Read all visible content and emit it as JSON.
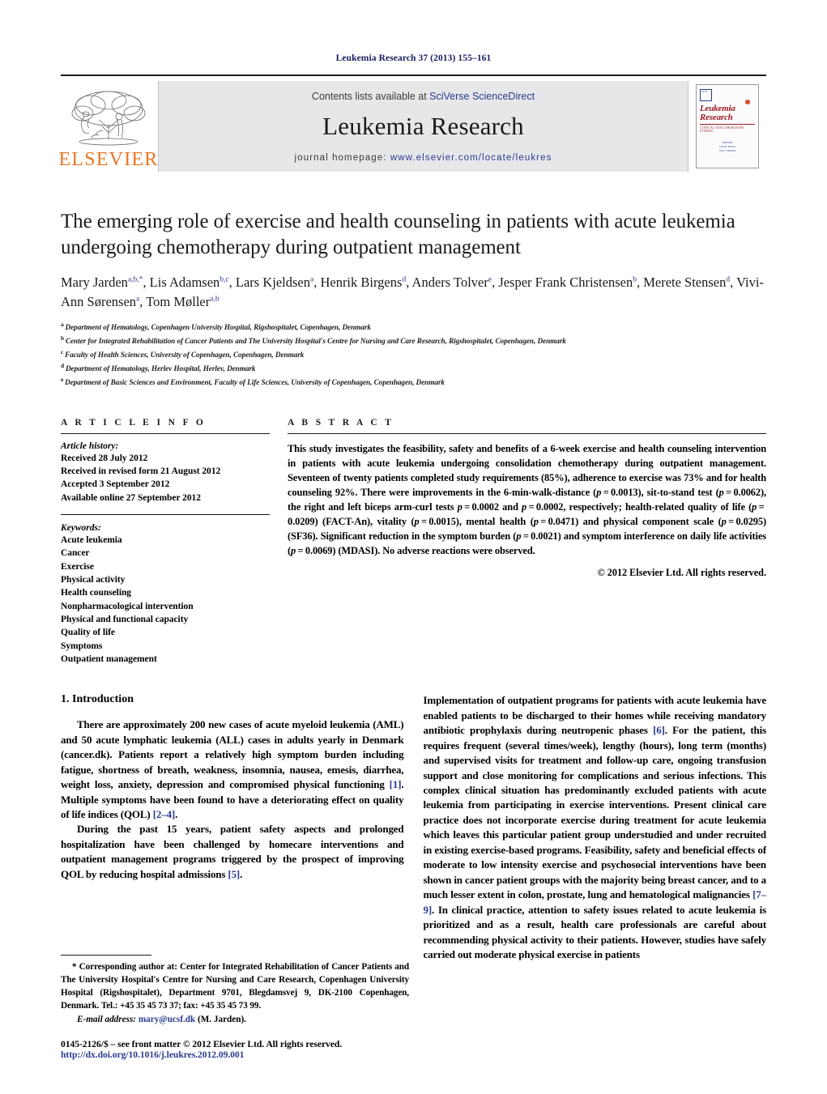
{
  "running_head": "Leukemia Research 37 (2013) 155–161",
  "masthead": {
    "publisher_logo_text": "ELSEVIER",
    "contents_prefix": "Contents lists available at ",
    "contents_link": "SciVerse ScienceDirect",
    "journal_name": "Leukemia Research",
    "homepage_label": "journal homepage:",
    "homepage_url": "www.elsevier.com/locate/leukres",
    "cover": {
      "title_line1": "Leukemia",
      "title_line2": "Research",
      "subtitle": "Clinical and Laboratory Studies",
      "badge": "IACR",
      "foot_label": "EDITORS",
      "foot_left_name": "John M. Bennett",
      "foot_left_place": "USA",
      "foot_right_name": "Terry J. Hamblin",
      "foot_right_place": "UK"
    }
  },
  "article": {
    "title": "The emerging role of exercise and health counseling in patients with acute leukemia undergoing chemotherapy during outpatient management",
    "authors_line1": "Mary Jarden",
    "authors_line1_sup": "a,b,*",
    "authors": [
      {
        "name": "Mary Jarden",
        "sup": "a,b,*"
      },
      {
        "name": "Lis Adamsen",
        "sup": "b,c"
      },
      {
        "name": "Lars Kjeldsen",
        "sup": "a"
      },
      {
        "name": "Henrik Birgens",
        "sup": "d"
      },
      {
        "name": "Anders Tolver",
        "sup": "e"
      },
      {
        "name": "Jesper Frank Christensen",
        "sup": "b"
      },
      {
        "name": "Merete Stensen",
        "sup": "d"
      },
      {
        "name": "Vivi-Ann Sørensen",
        "sup": "a"
      },
      {
        "name": "Tom Møller",
        "sup": "a,b"
      }
    ],
    "affiliations": [
      {
        "mark": "a",
        "text": "Department of Hematology, Copenhagen University Hospital, Rigshospitalet, Copenhagen, Denmark"
      },
      {
        "mark": "b",
        "text": "Center for Integrated Rehabilitation of Cancer Patients and The University Hospital's Centre for Nursing and Care Research, Rigshospitalet, Copenhagen, Denmark"
      },
      {
        "mark": "c",
        "text": "Faculty of Health Sciences, University of Copenhagen, Copenhagen, Denmark"
      },
      {
        "mark": "d",
        "text": "Department of Hematology, Herlev Hospital, Herlev, Denmark"
      },
      {
        "mark": "e",
        "text": "Department of Basic Sciences and Environment, Faculty of Life Sciences, University of Copenhagen, Copenhagen, Denmark"
      }
    ]
  },
  "article_info": {
    "heading": "A R T I C L E   I N F O",
    "history_label": "Article history:",
    "history": [
      "Received 28 July 2012",
      "Received in revised form 21 August 2012",
      "Accepted 3 September 2012",
      "Available online 27 September 2012"
    ],
    "keywords_label": "Keywords:",
    "keywords": [
      "Acute leukemia",
      "Cancer",
      "Exercise",
      "Physical activity",
      "Health counseling",
      "Nonpharmacological intervention",
      "Physical and functional capacity",
      "Quality of life",
      "Symptoms",
      "Outpatient management"
    ]
  },
  "abstract": {
    "heading": "A B S T R A C T",
    "text": "This study investigates the feasibility, safety and benefits of a 6-week exercise and health counseling intervention in patients with acute leukemia undergoing consolidation chemotherapy during outpatient management. Seventeen of twenty patients completed study requirements (85%), adherence to exercise was 73% and for health counseling 92%. There were improvements in the 6-min-walk-distance (p = 0.0013), sit-to-stand test (p = 0.0062), the right and left biceps arm-curl tests p = 0.0002 and p = 0.0002, respectively; health-related quality of life (p = 0.0209) (FACT-An), vitality (p = 0.0015), mental health (p = 0.0471) and physical component scale (p = 0.0295) (SF36). Significant reduction in the symptom burden (p = 0.0021) and symptom interference on daily life activities (p = 0.0069) (MDASI). No adverse reactions were observed.",
    "copyright": "© 2012 Elsevier Ltd. All rights reserved."
  },
  "introduction": {
    "section_number_title": "1.  Introduction",
    "left_paragraph_1": "There are approximately 200 new cases of acute myeloid leukemia (AML) and 50 acute lymphatic leukemia (ALL) cases in adults yearly in Denmark (cancer.dk). Patients report a relatively high symptom burden including fatigue, shortness of breath, weakness, insomnia, nausea, emesis, diarrhea, weight loss, anxiety, depression and compromised physical functioning [1]. Multiple symptoms have been found to have a deteriorating effect on quality of life indices (QOL) [2–4].",
    "left_paragraph_2": "During the past 15 years, patient safety aspects and prolonged hospitalization have been challenged by homecare interventions and outpatient management programs triggered by the prospect of improving QOL by reducing hospital admissions [5].",
    "right_paragraph_1": "Implementation of outpatient programs for patients with acute leukemia have enabled patients to be discharged to their homes while receiving mandatory antibiotic prophylaxis during neutropenic phases [6]. For the patient, this requires frequent (several times/week), lengthy (hours), long term (months) and supervised visits for treatment and follow-up care, ongoing transfusion support and close monitoring for complications and serious infections. This complex clinical situation has predominantly excluded patients with acute leukemia from participating in exercise interventions. Present clinical care practice does not incorporate exercise during treatment for acute leukemia which leaves this particular patient group understudied and under recruited in existing exercise-based programs. Feasibility, safety and beneficial effects of moderate to low intensity exercise and psychosocial interventions have been shown in cancer patient groups with the majority being breast cancer, and to a much lesser extent in colon, prostate, lung and hematological malignancies [7–9]. In clinical practice, attention to safety issues related to acute leukemia is prioritized and as a result, health care professionals are careful about recommending physical activity to their patients. However, studies have safely carried out moderate physical exercise in patients"
  },
  "footnotes": {
    "corresponding": "* Corresponding author at: Center for Integrated Rehabilitation of Cancer Patients and The University Hospital's Centre for Nursing and Care Research, Copenhagen University Hospital (Rigshospitalet), Department 9701, Blegdamsvej 9, DK-2100 Copenhagen, Denmark. Tel.: +45 35 45 73 37; fax: +45 35 45 73 99.",
    "email_label": "E-mail address:",
    "email": "mary@ucsf.dk",
    "email_owner": "(M. Jarden)."
  },
  "imprint": {
    "line1": "0145-2126/$ – see front matter © 2012 Elsevier Ltd. All rights reserved.",
    "doi": "http://dx.doi.org/10.1016/j.leukres.2012.09.001"
  },
  "colors": {
    "link_blue": "#2b3a8f",
    "elsevier_orange": "#e87722",
    "cover_red": "#9b1b23",
    "masthead_grey": "#e6e7e9"
  }
}
